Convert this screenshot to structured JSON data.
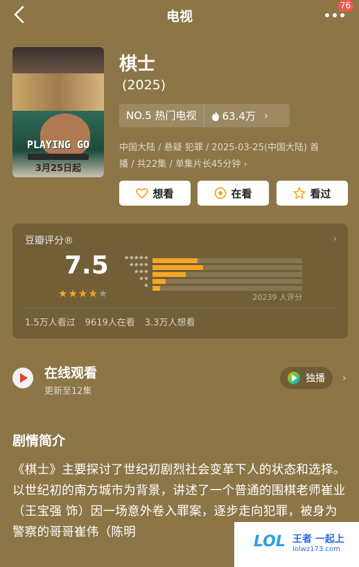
{
  "nav": {
    "title": "电视",
    "badge": "76"
  },
  "poster": {
    "title_text": "PLAYING GO",
    "date_text": "3月25日起"
  },
  "show": {
    "title": "棋士",
    "year": "(2025)",
    "rank": "NO.5 热门电视",
    "heat": "63.4万",
    "meta_line1": "中国大陆 / 悬疑 犯罪 / 2025-03-25(中国大陆) 首",
    "meta_line2": "播 / 共22集 / 单集片长45分钟 ›"
  },
  "actions": {
    "want": "想看",
    "watching": "在看",
    "watched": "看过"
  },
  "rating": {
    "label": "豆瓣评分®",
    "score": "7.5",
    "stars_filled": 4,
    "stars_total": 5,
    "distribution": [
      {
        "stars": "★★★★★",
        "value": 0.3
      },
      {
        "stars": "★★★★",
        "value": 0.34
      },
      {
        "stars": "★★★",
        "value": 0.22
      },
      {
        "stars": "★★",
        "value": 0.09
      },
      {
        "stars": "★",
        "value": 0.05
      }
    ],
    "count": "20239 人评分",
    "stats": [
      "1.5万人看过",
      "9619人在看",
      "3.3万人想看"
    ]
  },
  "online": {
    "title": "在线观看",
    "subtitle": "更新至12集",
    "exclusive": "独播"
  },
  "synopsis": {
    "title": "剧情简介",
    "text": "《棋士》主要探讨了世纪初剧烈社会变革下人的状态和选择。以世纪初的南方城市为背景，讲述了一个普通的围棋老师崔业（王宝强 饰）因一场意外卷入罪案，逐步走向犯罪，被身为警察的哥哥崔伟（陈明"
  },
  "watermark": {
    "brand": "王者 一起上",
    "url": "lolwz173.com",
    "logo": "LOL"
  },
  "colors": {
    "background": "#8c7547",
    "accent": "#f5a623",
    "play": "#e8402e"
  }
}
